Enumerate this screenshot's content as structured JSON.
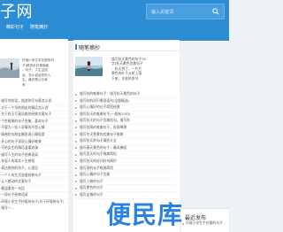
{
  "header": {
    "logo": "子网",
    "search_placeholder": "输入关键词",
    "nav": [
      "",
      "精彩句子",
      "随笔摘抄"
    ]
  },
  "left": {
    "feature_lines": [
      "环境小学生手抄报的句",
      "子(精选手抄报版面",
      "：句子，人生当如",
      "此，怎么说这样的人",
      "生，最好是心中有",
      "有"
    ],
    "list": [
      "·描写你的话，描述你写句意怎么说",
      "·对于一个早的朋友的情话怎么说",
      "·关于秋天写真风格的经典文案句子",
      "·个性唯美的句子合集，喜欢句子",
      "·不要为一些人说情的不是心情",
      "·情感短句朋友圈说说心情短语",
      "·开心的句子说说心情好唯美",
      "·写给女生的情话温柔浪漫",
      "·描写人生的句子经典语录",
      "·年轻人的现实人生感悟",
      "·表达想你的句子，心里话",
      "·一个人的生活态度经典句子",
      "·让人感动的文案句子",
      "·最温柔的一句话",
      "·一段句子经典语录"
    ],
    "bottom": [
      "·环境小学生手抄报的句子(关于环境的句子)",
      "·描写一..."
    ]
  },
  "middle": {
    "title": "随笔摘抄",
    "feature_lines": [
      "描写秋天景色的句子30",
      "字(秋天景色优美句子",
      "：秋天到了，一片片",
      "黄色的叶子从树上落",
      "下来，丰收的季节"
    ],
    "list": [
      "描写秋的唯美句子：描写秋天景色的句子",
      "描写秋的初识景观语句(全部精选)",
      "描写心情好的句子简短经典",
      "描写秋天的唯美句子(一般有20句)",
      "描写秋天的句子优美短句，描写秋",
      "描写秋雨的唯美句子，秋雨绵绵",
      "描写冬天雪景的优美句子唯美",
      "描写秋天的句子摘抄大全",
      "描写春天景色的句子，春风拂面",
      "描写夏天的句子唯美简短",
      "描写秋天的好词好句摘抄",
      "描写雨的句子唯美简短",
      "描写心情的句子优美",
      "描写人物的句子",
      "描写景色的句子",
      "描写友情的句子"
    ]
  },
  "right": {
    "title": "最近发布",
    "items": [
      "环境小学生手抄报的句子"
    ]
  },
  "watermark": "便民库"
}
